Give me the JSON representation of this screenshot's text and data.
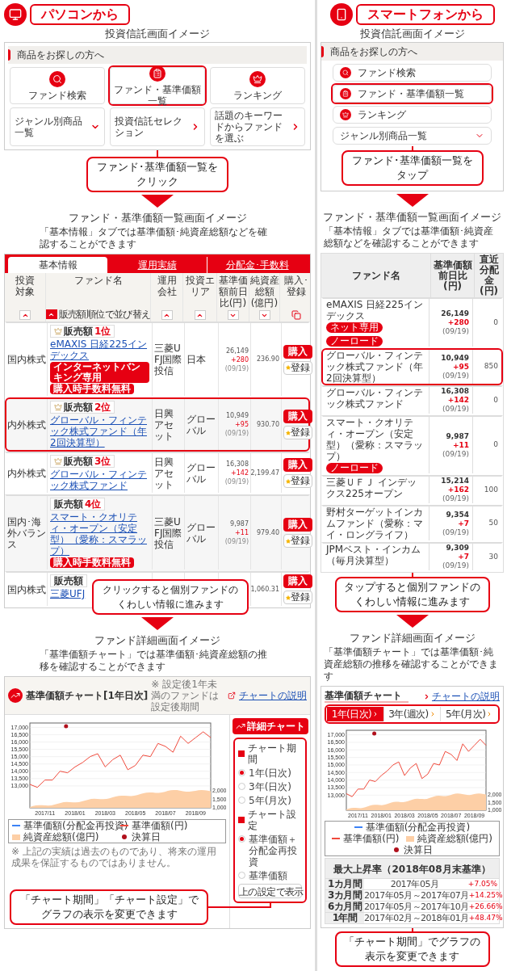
{
  "pc": {
    "badge": "パソコンから",
    "menu_screen": {
      "title": "投資信託画面イメージ",
      "panel_title": "商品をお探しの方へ",
      "tiles": [
        {
          "label": "ファンド検索",
          "highlighted": false
        },
        {
          "label": "ファンド・基準価額一覧",
          "highlighted": true
        },
        {
          "label": "ランキング",
          "highlighted": false
        }
      ],
      "links": [
        {
          "label": "ジャンル別商品一覧",
          "kind": "dropdown"
        },
        {
          "label": "投資信託セレクション",
          "kind": "link"
        },
        {
          "label": "話題のキーワードからファンドを選ぶ",
          "kind": "link"
        }
      ],
      "callout": "ファンド･基準価額一覧をクリック"
    },
    "list_screen": {
      "title": "ファンド・基準価額一覧画面イメージ",
      "description": "「基本情報」タブでは基準価額･純資産総額などを確認することができます",
      "tabs": [
        {
          "label": "基本情報",
          "selected": true
        },
        {
          "label": "運用実績",
          "selected": false
        },
        {
          "label": "分配金･手数料",
          "selected": false
        }
      ],
      "columns": [
        {
          "label": "投資対象",
          "kind": "sortable",
          "sort_desc": false,
          "active": false
        },
        {
          "label": "ファンド名",
          "kind": "sortable",
          "sort_desc": false,
          "active": true,
          "sort_label": "販売額順位で並び替え"
        },
        {
          "label": "運用会社",
          "kind": "sortable",
          "sort_desc": false,
          "active": false
        },
        {
          "label": "投資エリア",
          "kind": "sortable",
          "sort_desc": false,
          "active": false
        },
        {
          "label": "基準価額前日比(円)",
          "kind": "sortable",
          "sort_desc": true,
          "active": false
        },
        {
          "label": "純資産総額(億円)",
          "kind": "sortable",
          "sort_desc": true,
          "active": false
        },
        {
          "label": "購入･登録",
          "kind": "action"
        }
      ],
      "rows": [
        {
          "category": "国内株式",
          "rank_label": "販売額",
          "rank": "1位",
          "medal": true,
          "name": "eMAXIS 日経225インデックス",
          "tags": [
            "インターネットバンキング専用",
            "購入時手数料無料"
          ],
          "company": "三菱UFJ国際投信",
          "area": "日本",
          "price": "26,149",
          "change": "+280",
          "date": "(09/19)",
          "assets": "236.90",
          "buy": "購入",
          "register": "登録",
          "highlighted": false
        },
        {
          "category": "内外株式",
          "rank_label": "販売額",
          "rank": "2位",
          "medal": true,
          "name": "グローバル・フィンテック株式ファンド（年2回決算型）",
          "company": "日興アセット",
          "area": "グローバル",
          "price": "10,949",
          "change": "+95",
          "date": "(09/19)",
          "assets": "930.70",
          "buy": "購入",
          "register": "登録",
          "highlighted": true
        },
        {
          "category": "内外株式",
          "rank_label": "販売額",
          "rank": "3位",
          "medal": true,
          "name": "グローバル・フィンテック株式ファンド",
          "company": "日興アセット",
          "area": "グローバル",
          "price": "16,308",
          "change": "+142",
          "date": "(09/19)",
          "assets": "2,199.47",
          "buy": "購入",
          "register": "登録",
          "highlighted": false
        },
        {
          "category": "国内･海外バランス",
          "rank_label": "販売額",
          "rank": "4位",
          "medal": false,
          "name": "スマート・クオリティ・オープン（安定型）（愛称：スマラップ）",
          "tags": [
            "購入時手数料無料"
          ],
          "company": "三菱UFJ国際投信",
          "area": "グローバル",
          "price": "9,987",
          "change": "+11",
          "date": "(09/19)",
          "assets": "979.40",
          "buy": "購入",
          "register": "登録",
          "highlighted": false
        },
        {
          "category": "国内株式",
          "rank_label": "販売額",
          "medal": false,
          "name": "三菱UFJ",
          "assets": "1,060.31",
          "buy": "購入",
          "register": "登録",
          "highlighted": false
        }
      ],
      "callout": "クリックすると個別ファンドのくわしい情報に進みます"
    },
    "detail_screen": {
      "title": "ファンド詳細画面イメージ",
      "description": "「基準価額チャート」では基準価額･純資産総額の推移を確認することができます",
      "chart_title": "基準価額チャート[1年日次]",
      "chart_note": "※ 設定後1年未満のファンドは設定後期間",
      "help_link": "チャートの説明",
      "chart_data": {
        "type": "line",
        "categories": [
          null,
          null,
          "2017/11",
          null,
          null,
          null,
          "2018/01",
          null,
          null,
          null,
          "2018/03",
          null,
          null,
          null,
          "2018/05",
          null,
          null,
          null,
          "2018/07",
          null,
          null,
          null,
          "2018/09",
          null,
          null
        ],
        "series": [
          {
            "name": "基準価額(円)",
            "color": "#f04a3c",
            "values": [
              13100,
              12900,
              13400,
              13400,
              14000,
              13900,
              14300,
              14600,
              15000,
              15200,
              14300,
              14800,
              15100,
              14100,
              14400,
              15100,
              15000,
              15900,
              15700,
              15300,
              16400,
              15900,
              16300,
              16700,
              16300
            ]
          }
        ],
        "ylim": [
          11500,
          17300
        ],
        "grid": true,
        "yticks": [
          {
            "value": 17000,
            "label": "17,000"
          },
          {
            "value": 16500,
            "label": "16,500"
          },
          {
            "value": 16000,
            "label": "16,000"
          },
          {
            "value": 15500,
            "label": "15,500"
          },
          {
            "value": 15000,
            "label": "15,000"
          },
          {
            "value": 14500,
            "label": "14,500"
          },
          {
            "value": 14000,
            "label": "14,000"
          },
          {
            "value": 13500,
            "label": "13,500"
          },
          {
            "value": 13000,
            "label": "13,000"
          }
        ]
      },
      "y2_labels": [
        "2,000",
        "1,500",
        "1,000"
      ],
      "legend": [
        {
          "label": "基準価額(分配金再投資)",
          "kind": "line",
          "color": "#3b82f6"
        },
        {
          "kind": "series"
        },
        {
          "label": "純資産総額(億円)",
          "kind": "area",
          "color": "#fdcfa6"
        },
        {
          "label": "決算日",
          "kind": "dot",
          "color": "#b0101c"
        }
      ],
      "detail_button": "詳細チャート",
      "options": [
        {
          "kind": "heading",
          "label": "チャート期間"
        },
        {
          "kind": "radio",
          "label": "1年(日次)",
          "selected": true
        },
        {
          "kind": "radio",
          "label": "3年(日次)",
          "selected": false
        },
        {
          "kind": "radio",
          "label": "5年(月次)",
          "selected": false
        },
        {
          "kind": "heading",
          "label": "チャート設定"
        },
        {
          "kind": "radio",
          "label": "基準価額＋分配金再投資",
          "selected": true
        },
        {
          "kind": "radio",
          "label": "基準価額",
          "selected": false
        }
      ],
      "apply_button": "上の設定で表示",
      "disclaimer": "※ 上記の実績は過去のものであり、将来の運用成果を保証するものではありません。",
      "callout": "「チャート期間」「チャート設定」でグラフの表示を変更できます"
    }
  },
  "sp": {
    "badge": "スマートフォンから",
    "menu_screen": {
      "title": "投資信託画面イメージ",
      "panel_title": "商品をお探しの方へ",
      "items": [
        {
          "label": "ファンド検索",
          "kind": "icon",
          "highlighted": false
        },
        {
          "label": "ファンド・基準価額一覧",
          "kind": "icon",
          "highlighted": true
        },
        {
          "label": "ランキング",
          "kind": "icon",
          "highlighted": false
        },
        {
          "label": "ジャンル別商品一覧",
          "kind": "dropdown",
          "highlighted": false
        }
      ],
      "callout": "ファンド･基準価額一覧をタップ"
    },
    "list_screen": {
      "title": "ファンド・基準価額一覧画面イメージ",
      "description": "「基本情報」タブでは基準価額･純資産総額などを確認することができます",
      "columns": [
        "ファンド名",
        "基準価額前日比(円)",
        "直近分配金(円)"
      ],
      "rows": [
        {
          "name": "eMAXIS 日経225インデックス",
          "tags": [
            "ネット専用",
            "ノーロード"
          ],
          "price": "26,149",
          "change": "+280",
          "date": "(09/19)",
          "distribution": "0",
          "highlighted": false
        },
        {
          "name": "グローバル・フィンテック株式ファンド（年2回決算型）",
          "price": "10,949",
          "change": "+95",
          "date": "(09/19)",
          "distribution": "850",
          "highlighted": true
        },
        {
          "name": "グローバル・フィンテック株式ファンド",
          "price": "16,308",
          "change": "+142",
          "date": "(09/19)",
          "distribution": "0",
          "highlighted": false
        },
        {
          "name": "スマート・クオリティ・オープン（安定型）（愛称：スマラップ）",
          "tags": [
            "ノーロード"
          ],
          "price": "9,987",
          "change": "+11",
          "date": "(09/19)",
          "distribution": "0",
          "highlighted": false
        },
        {
          "name": "三菱ＵＦＪ インデックス225オープン",
          "price": "15,214",
          "change": "+162",
          "date": "(09/19)",
          "distribution": "100",
          "highlighted": false
        },
        {
          "name": "野村ターゲットインカムファンド（愛称：マイ・ロングライフ）",
          "price": "9,354",
          "change": "+7",
          "date": "(09/19)",
          "distribution": "50",
          "highlighted": false
        },
        {
          "name": "JPMベスト・インカム（毎月決算型）",
          "price": "9,309",
          "change": "+7",
          "date": "(09/19)",
          "distribution": "30",
          "highlighted": false
        }
      ],
      "callout": "タップすると個別ファンドのくわしい情報に進みます"
    },
    "detail_screen": {
      "title": "ファンド詳細画面イメージ",
      "description": "「基準価額チャート」では基準価額･純資産総額の推移を確認することができます",
      "chart_title": "基準価額チャート",
      "help_link": "チャートの説明",
      "tabs": [
        {
          "label": "1年(日次)",
          "selected": true
        },
        {
          "label": "3年(週次)",
          "selected": false
        },
        {
          "label": "5年(月次)",
          "selected": false
        }
      ],
      "chart_data": {
        "type": "line",
        "categories": [
          null,
          null,
          "2017/11",
          null,
          null,
          null,
          "2018/01",
          null,
          null,
          null,
          "2018/03",
          null,
          null,
          null,
          "2018/05",
          null,
          null,
          null,
          "2018/07",
          null,
          null,
          null,
          "2018/09",
          null,
          null
        ],
        "series": [
          {
            "name": "基準価額(円)",
            "color": "#f04a3c",
            "values": [
              13100,
              12900,
              13400,
              13400,
              14000,
              13900,
              14300,
              14600,
              15000,
              15200,
              14300,
              14800,
              15100,
              14100,
              14400,
              15100,
              15000,
              15900,
              15700,
              15300,
              16400,
              15900,
              16300,
              16700,
              16300
            ]
          }
        ],
        "ylim": [
          12000,
          17300
        ],
        "grid": true,
        "yticks": [
          {
            "value": 17000,
            "label": "17,000"
          },
          {
            "value": 16500,
            "label": "16,500"
          },
          {
            "value": 16000,
            "label": "16,000"
          },
          {
            "value": 15500,
            "label": "15,500"
          },
          {
            "value": 15000,
            "label": "15,000"
          },
          {
            "value": 14500,
            "label": "14,500"
          },
          {
            "value": 14000,
            "label": "14,000"
          },
          {
            "value": 13500,
            "label": "13,500"
          },
          {
            "value": 13000,
            "label": "13,000"
          }
        ]
      },
      "y2_labels": [
        "2,000",
        "1,500",
        "1,000"
      ],
      "legend": [
        {
          "label": "基準価額(分配金再投資)",
          "kind": "line",
          "color": "#3b82f6"
        },
        {
          "kind": "series"
        },
        {
          "label": "純資産総額(億円)",
          "kind": "area",
          "color": "#fdcfa6"
        },
        {
          "label": "決算日",
          "kind": "dot",
          "color": "#b0101c"
        }
      ],
      "returns": {
        "title": "最大上昇率（2018年08月末基準）",
        "rows": [
          {
            "period": "1カ月間",
            "range": "2017年05月",
            "value": "+7.05%"
          },
          {
            "period": "3カ月間",
            "range": "2017年05月～2017年07月",
            "value": "+14.25%"
          },
          {
            "period": "6カ月間",
            "range": "2017年05月～2017年10月",
            "value": "+26.66%"
          },
          {
            "period": "1年間",
            "range": "2017年02月～2018年01月",
            "value": "+48.47%"
          }
        ]
      },
      "callout": "「チャート期間」でグラフの表示を変更できます"
    }
  }
}
